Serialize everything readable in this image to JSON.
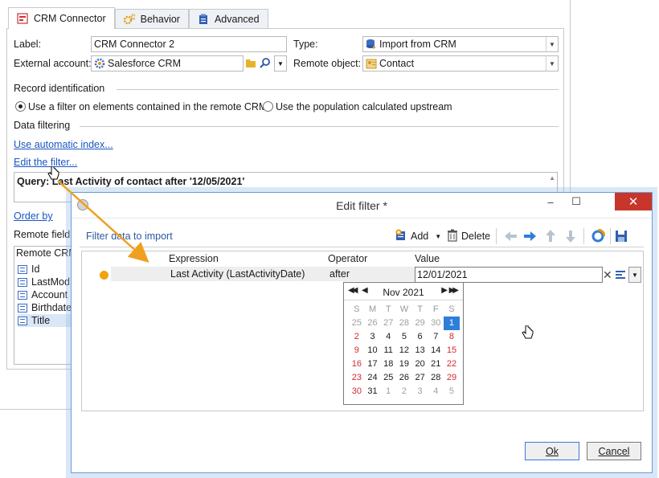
{
  "tabs": [
    {
      "label": "CRM Connector",
      "icon": "crm-connector-icon"
    },
    {
      "label": "Behavior",
      "icon": "gears-icon"
    },
    {
      "label": "Advanced",
      "icon": "clipboard-icon"
    }
  ],
  "form": {
    "label_caption": "Label:",
    "label_value": "CRM Connector 2",
    "type_caption": "Type:",
    "type_value": "Import from CRM",
    "external_account_caption": "External account:",
    "external_account_value": "Salesforce CRM",
    "remote_object_caption": "Remote object:",
    "remote_object_value": "Contact"
  },
  "record_identification": {
    "title": "Record identification",
    "option1": "Use a filter on elements contained in the remote CRM",
    "option2": "Use the population calculated upstream",
    "selected": "option1"
  },
  "data_filtering": {
    "title": "Data filtering",
    "auto_index_link": "Use automatic index...",
    "edit_filter_link": "Edit the filter...",
    "query_label": "Query:",
    "query_text": "Last Activity of contact after '12/05/2021'"
  },
  "order_by_link": "Order by",
  "remote_fields": {
    "title": "Remote field",
    "column": "Remote CRM",
    "items": [
      "Id",
      "LastMod",
      "Account",
      "Birthdate",
      "Title"
    ],
    "selected": "Title"
  },
  "dialog": {
    "title": "Edit filter *",
    "toolbar_title": "Filter data to import",
    "add_label": "Add",
    "delete_label": "Delete",
    "columns": {
      "expression": "Expression",
      "operator": "Operator",
      "value": "Value"
    },
    "row": {
      "expression": "Last Activity (LastActivityDate)",
      "operator": "after",
      "value": "12/01/2021"
    },
    "ok_label": "Ok",
    "cancel_label": "Cancel"
  },
  "calendar": {
    "month": "Nov 2021",
    "dow": [
      "S",
      "M",
      "T",
      "W",
      "T",
      "F",
      "S"
    ],
    "weeks": [
      [
        "25",
        "26",
        "27",
        "28",
        "29",
        "30",
        "1"
      ],
      [
        "2",
        "3",
        "4",
        "5",
        "6",
        "7",
        "8"
      ],
      [
        "9",
        "10",
        "11",
        "12",
        "13",
        "14",
        "15"
      ],
      [
        "16",
        "17",
        "18",
        "19",
        "20",
        "21",
        "22"
      ],
      [
        "23",
        "24",
        "25",
        "26",
        "27",
        "28",
        "29"
      ],
      [
        "30",
        "31",
        "1",
        "2",
        "3",
        "4",
        "5"
      ]
    ],
    "selected_day": "1",
    "colors": {
      "weekend": "#d62a2a",
      "selected": "#2f7ed8",
      "other_month": "#a0a0a0"
    }
  },
  "colors": {
    "accent": "#f2a20c",
    "link": "#1a56c2",
    "close_button": "#c8352b"
  }
}
